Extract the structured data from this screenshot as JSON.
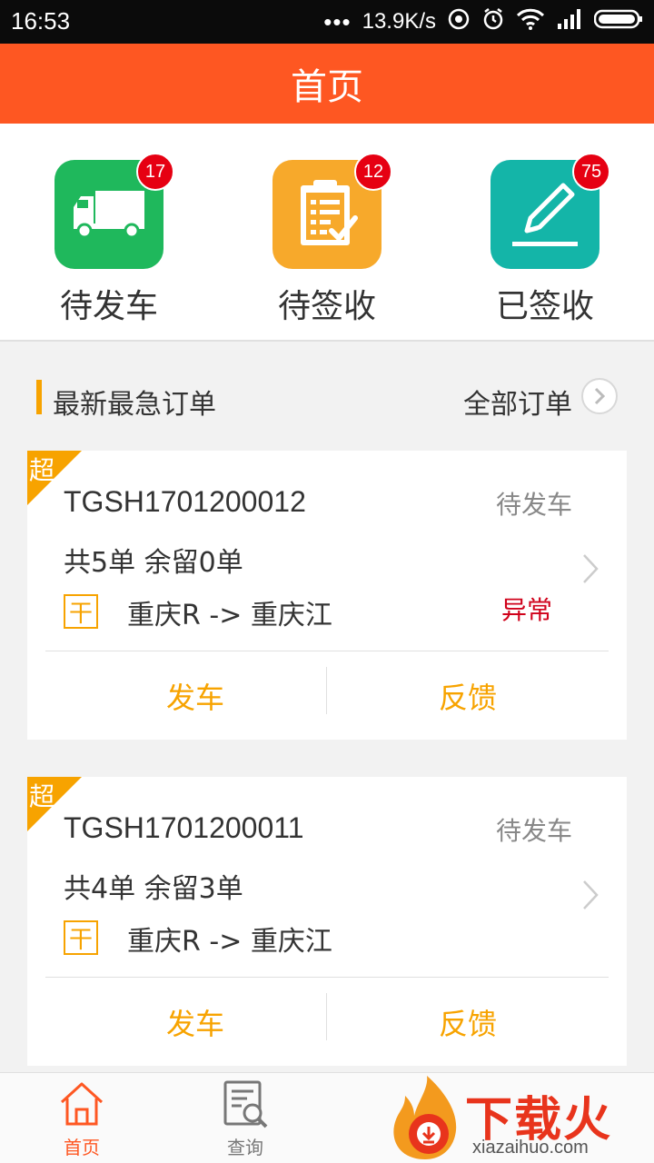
{
  "statusbar": {
    "time": "16:53",
    "dots": "•••",
    "net_speed": "13.9K/s"
  },
  "header": {
    "title": "首页"
  },
  "quick": [
    {
      "label": "待发车",
      "badge": "17",
      "color": "#1fb85c",
      "icon": "truck-icon"
    },
    {
      "label": "待签收",
      "badge": "12",
      "color": "#f7a92b",
      "icon": "clipboard-check-icon"
    },
    {
      "label": "已签收",
      "badge": "75",
      "color": "#14b5a8",
      "icon": "pen-sign-icon"
    }
  ],
  "section": {
    "title": "最新最急订单",
    "all_label": "全部订单"
  },
  "orders": [
    {
      "corner": "超",
      "order_no": "TGSH1701200012",
      "status": "待发车",
      "summary": "共5单 余留0单",
      "tag": "干",
      "route": "重庆R -> 重庆江",
      "abnormal": "异常",
      "depart_label": "发车",
      "feedback_label": "反馈"
    },
    {
      "corner": "超",
      "order_no": "TGSH1701200011",
      "status": "待发车",
      "summary": "共4单 余留3单",
      "tag": "干",
      "route": "重庆R -> 重庆江",
      "abnormal": "",
      "depart_label": "发车",
      "feedback_label": "反馈"
    }
  ],
  "tabs": [
    {
      "label": "首页",
      "icon": "home-icon",
      "active": true,
      "color": "#fe5722"
    },
    {
      "label": "查询",
      "icon": "search-doc-icon",
      "active": false,
      "color": "#777777"
    }
  ],
  "watermark": {
    "main": "下载火",
    "sub": "xiazaihuo.com"
  }
}
